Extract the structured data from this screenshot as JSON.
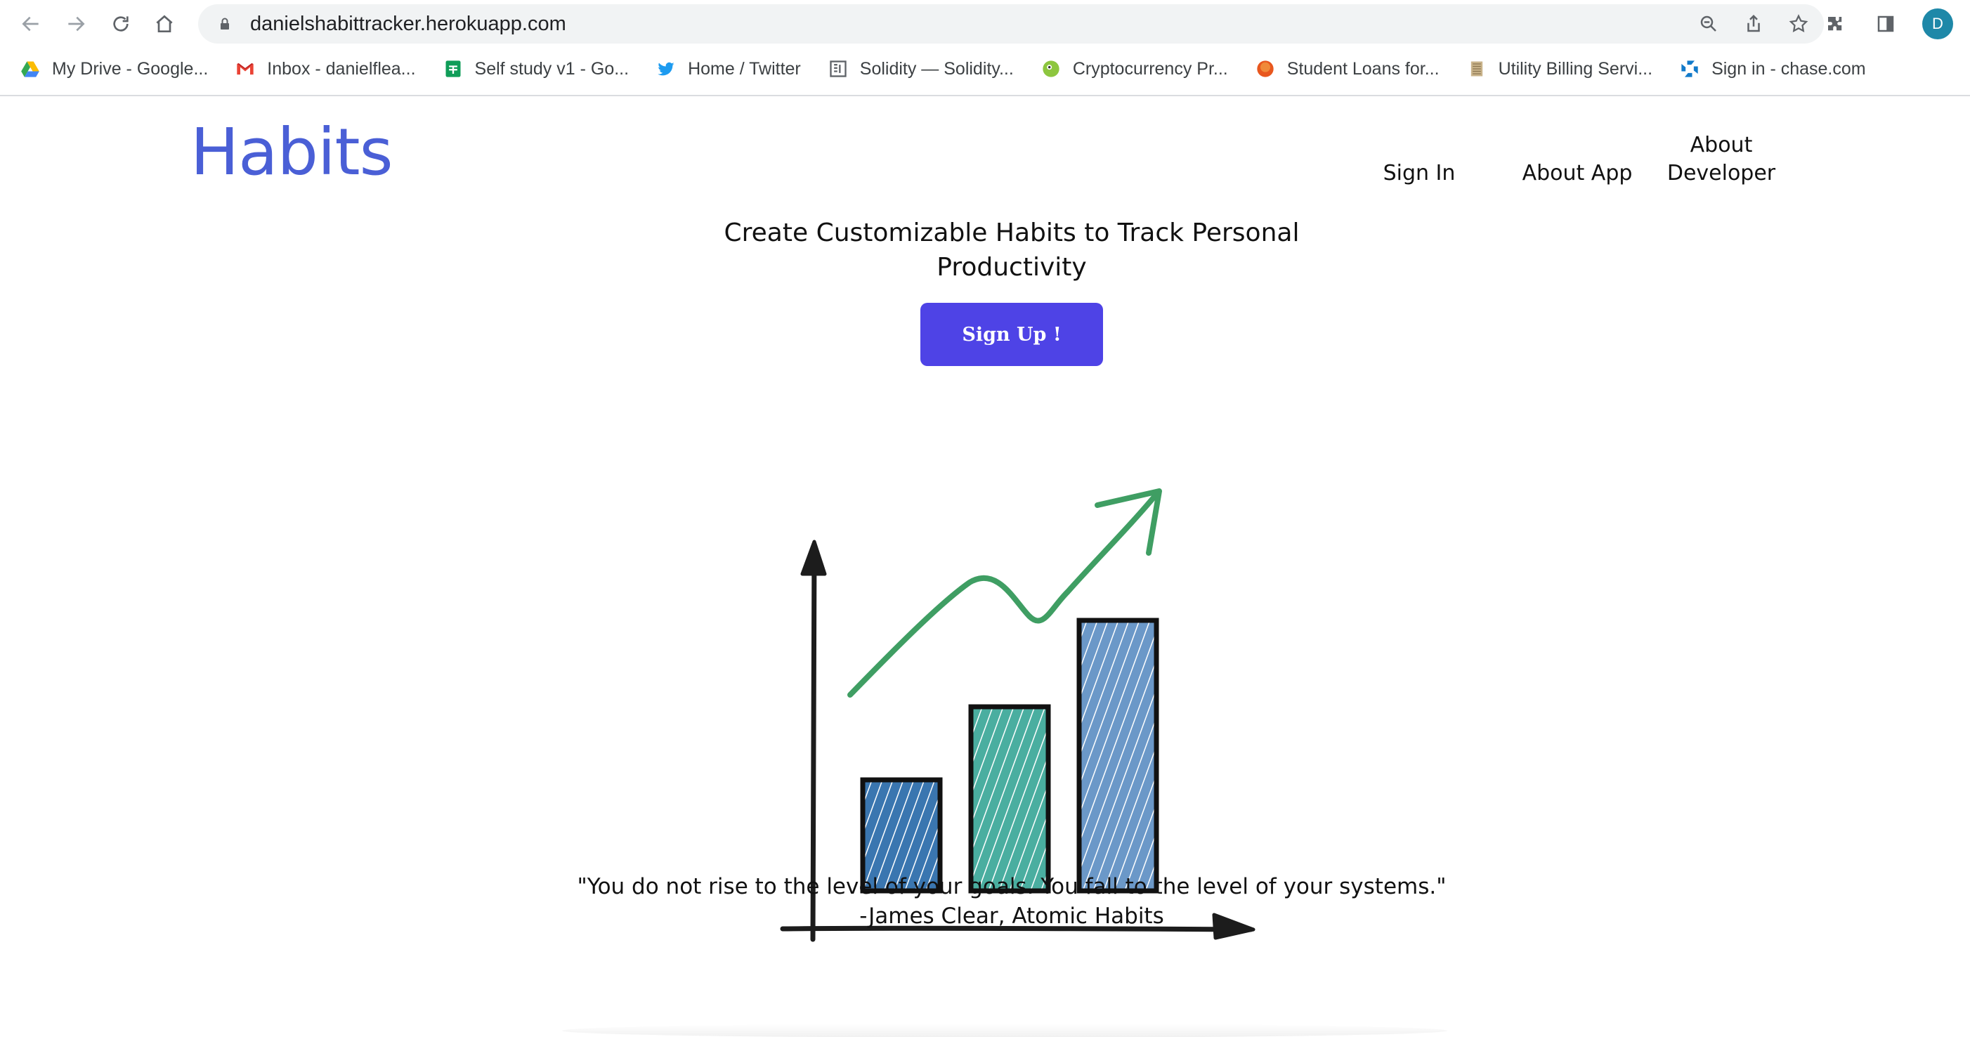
{
  "browser": {
    "url": "danielshabittracker.herokuapp.com",
    "avatar_initial": "D",
    "bookmarks": [
      {
        "label": "My Drive - Google...",
        "icon": "google-drive-icon"
      },
      {
        "label": "Inbox - danielflea...",
        "icon": "gmail-icon"
      },
      {
        "label": "Self study v1 - Go...",
        "icon": "google-sheets-icon"
      },
      {
        "label": "Home / Twitter",
        "icon": "twitter-icon"
      },
      {
        "label": "Solidity — Solidity...",
        "icon": "solidity-icon"
      },
      {
        "label": "Cryptocurrency Pr...",
        "icon": "coingecko-icon"
      },
      {
        "label": "Student Loans for...",
        "icon": "student-loans-icon"
      },
      {
        "label": "Utility Billing Servi...",
        "icon": "utility-billing-icon"
      },
      {
        "label": "Sign in - chase.com",
        "icon": "chase-icon"
      }
    ]
  },
  "header": {
    "logo": "Habits",
    "nav": {
      "sign_in": "Sign In",
      "about_app": "About App",
      "about_developer": "About Developer"
    }
  },
  "hero": {
    "headline": "Create Customizable Habits to Track Personal Productivity",
    "signup_label": "Sign Up !"
  },
  "quote": {
    "text": "\"You do not rise to the level of your goals. You fall to the level of your systems.\"",
    "attribution": "-James Clear, Atomic Habits"
  },
  "colors": {
    "logo": "#4a5fd6",
    "signup_button": "#4e43e6",
    "bar1": "#3a76b0",
    "bar2": "#4aaea0",
    "bar3": "#6b98c8",
    "arrow": "#3f9e63"
  }
}
